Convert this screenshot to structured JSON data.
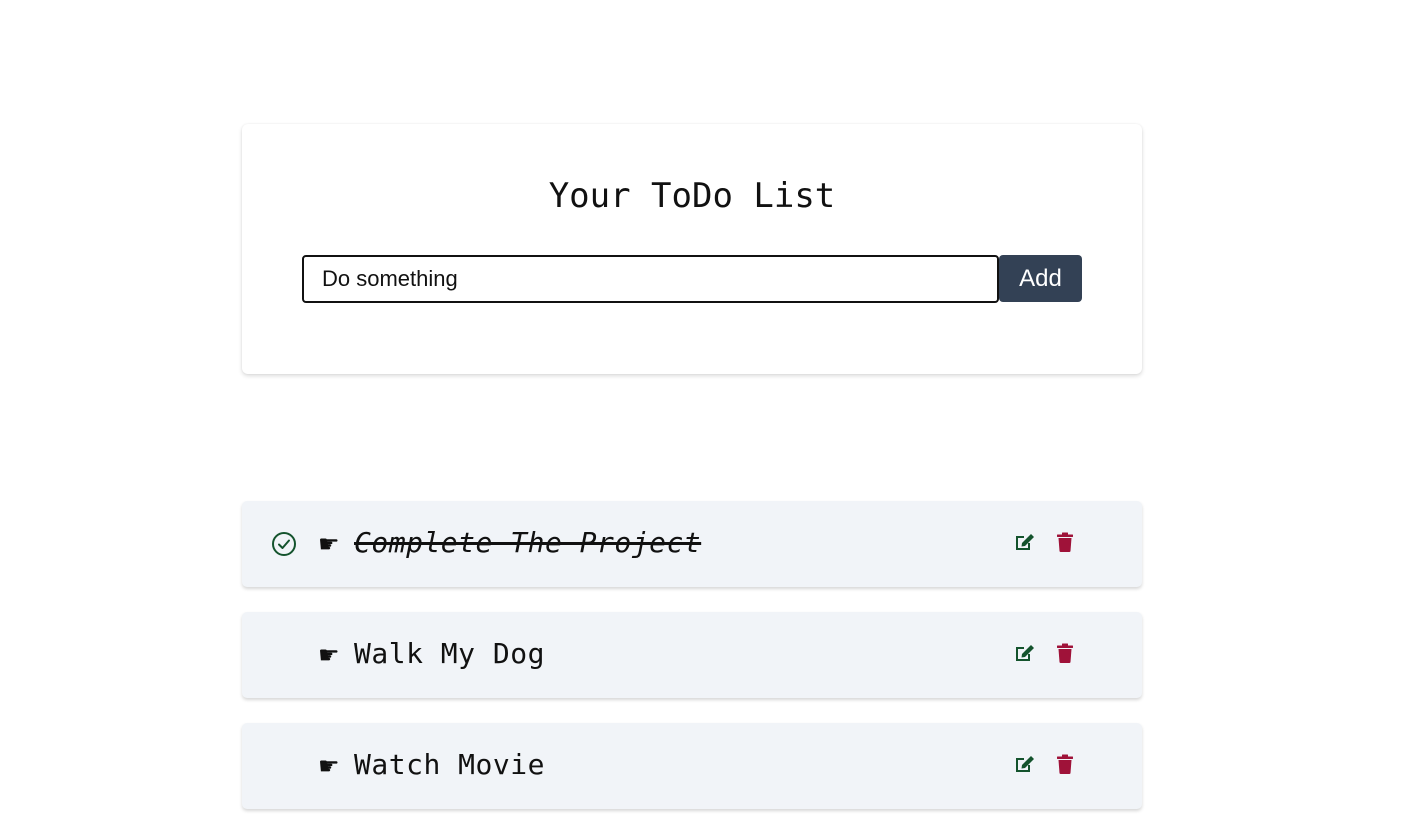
{
  "header": {
    "title": "Your ToDo List"
  },
  "input": {
    "value": "Do something",
    "placeholder": "Do something"
  },
  "add_button": {
    "label": "Add"
  },
  "todos": [
    {
      "bullet": "☛",
      "text": "Complete The Project",
      "completed": true
    },
    {
      "bullet": "☛",
      "text": "Walk My Dog",
      "completed": false
    },
    {
      "bullet": "☛",
      "text": "Watch Movie",
      "completed": false
    }
  ],
  "icons": {
    "complete": "check-circle-icon",
    "edit": "edit-icon",
    "delete": "trash-icon"
  },
  "colors": {
    "add_button_bg": "#334155",
    "item_bg": "#f1f4f8",
    "edit_icon": "#14532d",
    "delete_icon": "#9f1239",
    "check_icon": "#14532d"
  }
}
